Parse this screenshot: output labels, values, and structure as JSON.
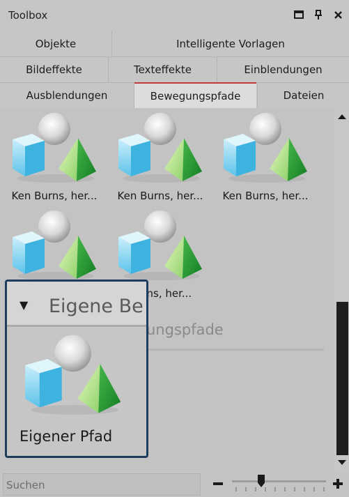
{
  "window": {
    "title": "Toolbox"
  },
  "tabs": {
    "row1": [
      {
        "label": "Objekte",
        "active": false
      },
      {
        "label": "Intelligente Vorlagen",
        "active": false
      }
    ],
    "row2": [
      {
        "label": "Bildeffekte",
        "active": false
      },
      {
        "label": "Texteffekte",
        "active": false
      },
      {
        "label": "Einblendungen",
        "active": false
      }
    ],
    "row3": [
      {
        "label": "Ausblendungen",
        "active": false
      },
      {
        "label": "Bewegungspfade",
        "active": true
      },
      {
        "label": "Dateien",
        "active": false
      }
    ]
  },
  "items": [
    {
      "label": "Ken Burns, her..."
    },
    {
      "label": "Ken Burns, her..."
    },
    {
      "label": "Ken Burns, her..."
    },
    {
      "label": ""
    },
    {
      "label": "Burns, her..."
    }
  ],
  "group_header_partial": "ungspfade",
  "popup": {
    "title": "Eigene Be",
    "item_label": "Eigener Pfad"
  },
  "bottom": {
    "search_placeholder": "Suchen"
  },
  "icons": {
    "maximize": "maximize-icon",
    "pin": "pin-icon",
    "close": "close-icon",
    "item": "objects-3d-icon",
    "collapse": "triangle-down-icon",
    "zoom_out": "minus-icon",
    "zoom_in": "plus-icon"
  },
  "colors": {
    "active_tab_accent": "#c0393b",
    "popup_border": "#1d3d5c"
  }
}
